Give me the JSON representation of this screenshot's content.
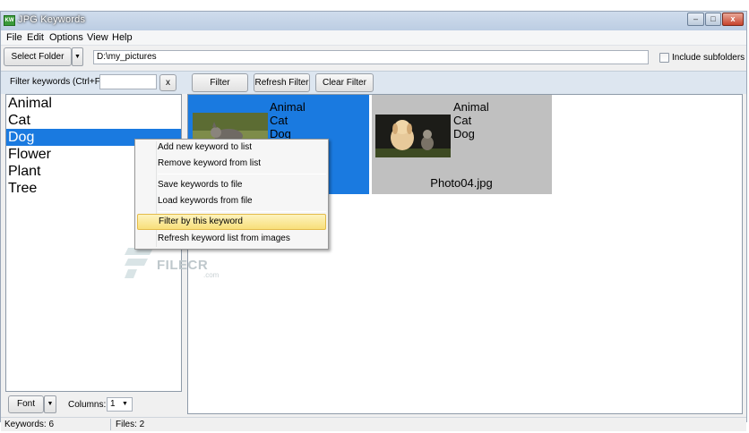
{
  "window": {
    "title": "JPG Keywords",
    "app_icon_text": "KW",
    "controls": {
      "minimize": "–",
      "maximize": "□",
      "close": "x"
    }
  },
  "menu": [
    "File",
    "Edit",
    "Options",
    "View",
    "Help"
  ],
  "toolbar": {
    "select_folder_label": "Select Folder",
    "dropdown_arrow": "▼",
    "path_value": "D:\\my_pictures",
    "include_subfolders_label": "Include subfolders",
    "include_subfolders_checked": false
  },
  "filter_bar": {
    "filter_keywords_label": "Filter keywords (Ctrl+F)",
    "filter_input_value": "",
    "clear_x_label": "x",
    "filter_button": "Filter",
    "refresh_filter_button": "Refresh Filter",
    "clear_filter_button": "Clear Filter"
  },
  "keywords": {
    "items": [
      "Animal",
      "Cat",
      "Dog",
      "Flower",
      "Plant",
      "Tree"
    ],
    "selected": "Dog"
  },
  "images": [
    {
      "keywords": [
        "Animal",
        "Cat",
        "Dog"
      ],
      "filename": "",
      "selected": true
    },
    {
      "keywords": [
        "Animal",
        "Cat",
        "Dog"
      ],
      "filename": "Photo04.jpg",
      "selected": false
    }
  ],
  "context_menu": {
    "items": [
      {
        "label": "Add new keyword to list",
        "hover": false
      },
      {
        "label": "Remove keyword from list",
        "hover": false
      },
      {
        "label": "Save keywords to file",
        "hover": false
      },
      {
        "label": "Load keywords from file",
        "hover": false
      },
      {
        "label": "Filter by this keyword",
        "hover": true
      },
      {
        "label": "Refresh keyword list from images",
        "hover": false
      }
    ]
  },
  "bottom": {
    "font_button": "Font",
    "columns_label": "Columns:",
    "columns_value": "1"
  },
  "statusbar": {
    "keywords": "Keywords: 6",
    "files": "Files: 2"
  },
  "watermark": {
    "text": "FILECR",
    "sub": ".com"
  },
  "colors": {
    "selection": "#1a7ae0",
    "thumb_unselected_bg": "#c0c0c0",
    "menu_hover": "#f8df7a"
  }
}
